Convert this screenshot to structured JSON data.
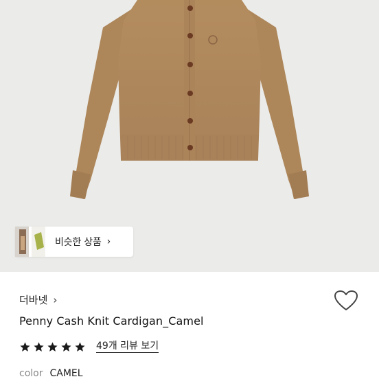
{
  "similar": {
    "label": "비슷한 상품",
    "chevron": "›"
  },
  "product": {
    "brand": "더바넷",
    "brand_chevron": "›",
    "title": "Penny Cash Knit Cardigan_Camel",
    "rating_stars": 5,
    "review_link": "49개 리뷰 보기",
    "color_label": "color",
    "color_value": "CAMEL"
  },
  "colors": {
    "hero_bg": "#ebebe9",
    "cardigan": "#b38b5d",
    "button": "#6b3a22",
    "star": "#1a1a1a"
  },
  "icons": {
    "wishlist": "heart-outline-icon",
    "star": "star-icon",
    "chevron": "chevron-right-icon"
  }
}
